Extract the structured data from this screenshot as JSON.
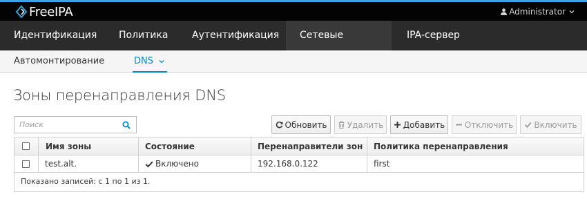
{
  "brand": {
    "name": "FreeIPA",
    "logo_icon": "freeipa-logo-icon"
  },
  "user": {
    "name": "Administrator",
    "icon": "user-icon"
  },
  "primary_nav": {
    "items": [
      {
        "label": "Идентификация",
        "active": false
      },
      {
        "label": "Политика",
        "active": false
      },
      {
        "label": "Аутентификация",
        "active": false
      },
      {
        "label": "Сетевые службы",
        "active": true
      },
      {
        "label": "IPA-сервер",
        "active": false
      }
    ]
  },
  "secondary_nav": {
    "items": [
      {
        "label": "Автомонтирование",
        "active": false
      },
      {
        "label": "DNS",
        "active": true,
        "has_dropdown": true
      }
    ]
  },
  "page": {
    "title": "Зоны перенаправления DNS"
  },
  "search": {
    "placeholder": "Поиск",
    "value": ""
  },
  "toolbar": {
    "refresh_label": "Обновить",
    "delete_label": "Удалить",
    "add_label": "Добавить",
    "disable_label": "Отключить",
    "enable_label": "Включить"
  },
  "table": {
    "columns": [
      "Имя зоны",
      "Состояние",
      "Перенаправители зон",
      "Политика перенаправления"
    ],
    "rows": [
      {
        "zone": "test.alt.",
        "state": "Включено",
        "forwarders": "192.168.0.122",
        "policy": "first"
      }
    ],
    "footer": "Показано записей: с 1 по 1 из 1."
  },
  "colors": {
    "accent": "#0088ce",
    "topbar": "#030303",
    "nav": "#2b2b2b",
    "nav_active": "#393939"
  }
}
